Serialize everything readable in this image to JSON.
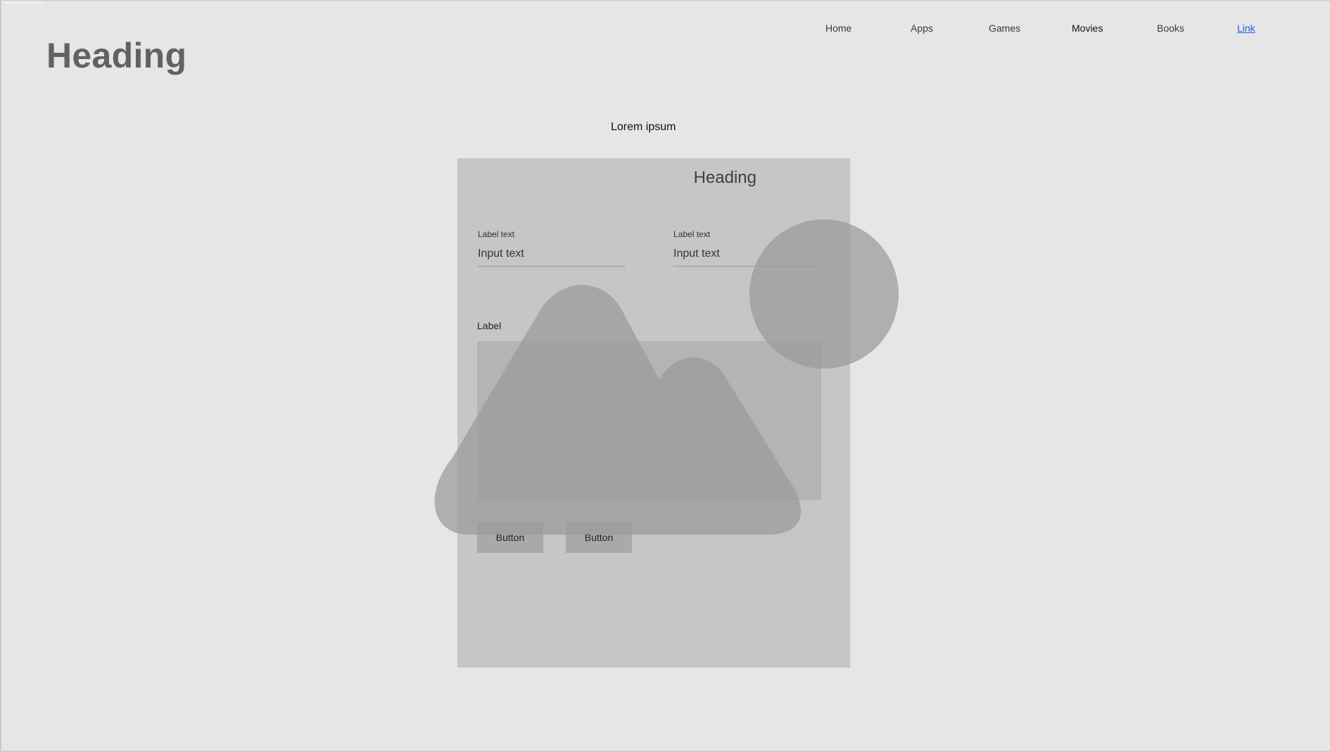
{
  "header": {
    "title": "Heading"
  },
  "nav": {
    "items": [
      {
        "label": "Home"
      },
      {
        "label": "Apps"
      },
      {
        "label": "Games"
      },
      {
        "label": "Movies"
      },
      {
        "label": "Books"
      },
      {
        "label": "Link"
      }
    ],
    "active_item": "Movies"
  },
  "main": {
    "caption": "Lorem ipsum",
    "card": {
      "heading": "Heading",
      "fields": [
        {
          "label": "Label text",
          "value": "Input text"
        },
        {
          "label": "Label text",
          "value": "Input text"
        }
      ],
      "textarea_label": "Label",
      "buttons": [
        {
          "label": "Button"
        },
        {
          "label": "Button"
        }
      ]
    }
  },
  "placeholder_image": {
    "icon": "image-placeholder-icon",
    "shapes": [
      "mountains",
      "sun-circle"
    ]
  },
  "colors": {
    "background": "#e6e6e6",
    "card": "#c6c6c6",
    "textarea": "#b4b4b4",
    "button": "#a9a9a9",
    "placeholder_shape": "#9a9a9a",
    "heading_text": "#626262",
    "link": "#1a63d6"
  }
}
